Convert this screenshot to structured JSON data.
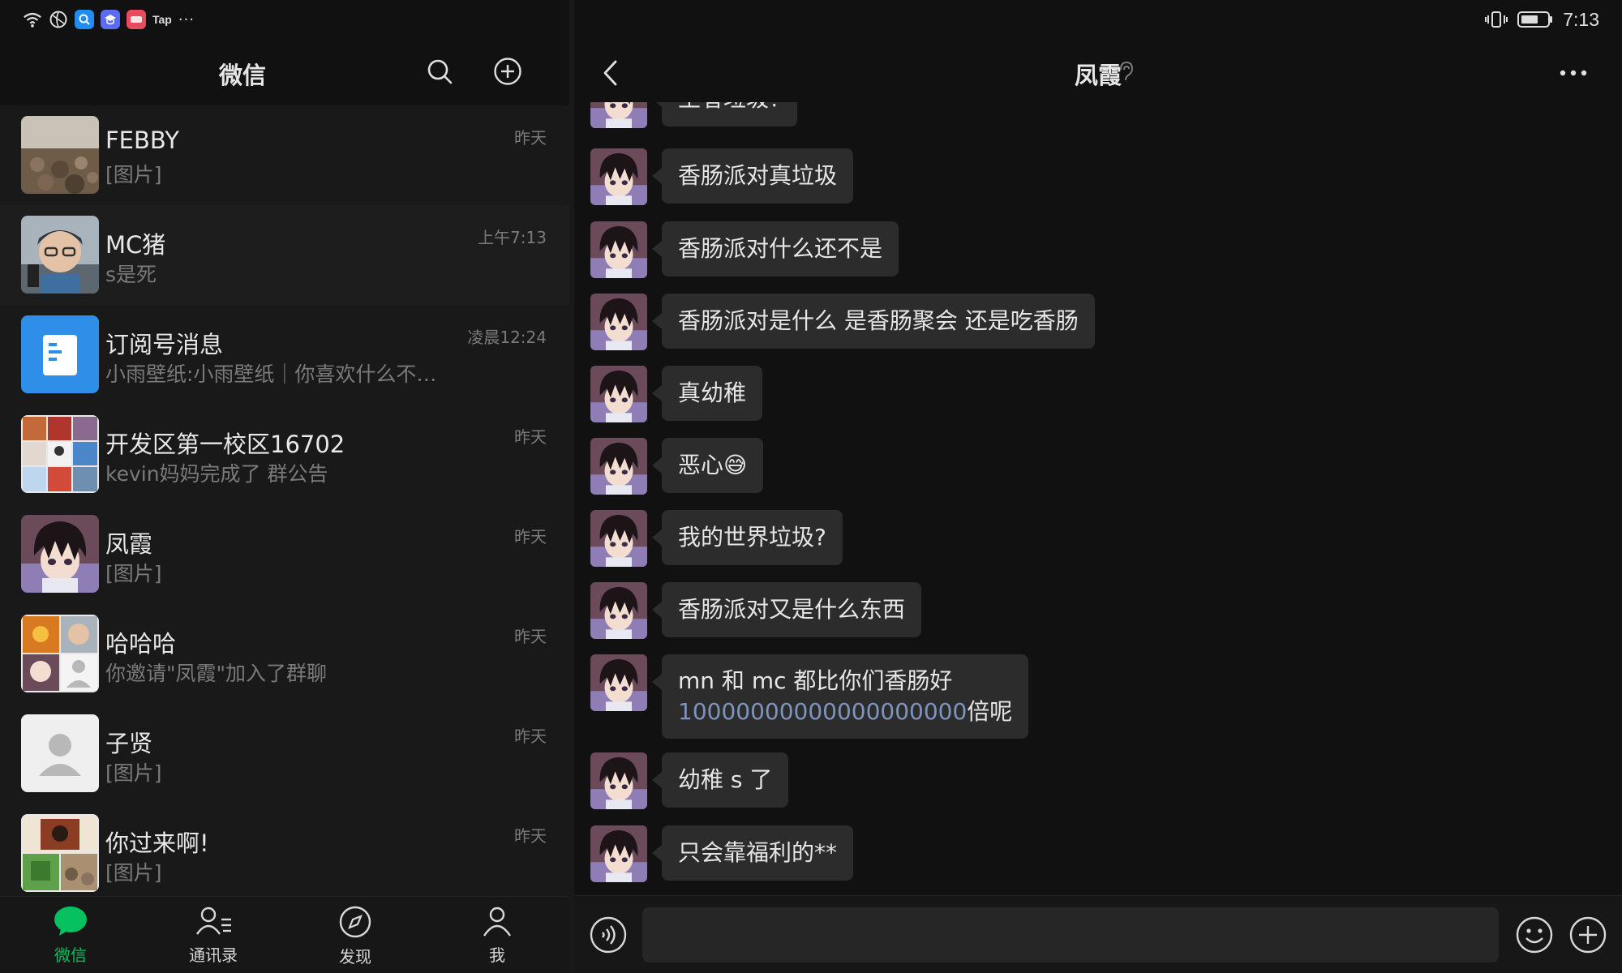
{
  "status_bar": {
    "tap_label": "Tap",
    "more_dots": "···",
    "time": "7:13"
  },
  "left_header": {
    "title": "微信"
  },
  "chats": [
    {
      "name": "FEBBY",
      "preview": "[图片]",
      "time": "昨天",
      "avatar": "sky-rocks"
    },
    {
      "name": "MC猪",
      "preview": "s是死",
      "time": "上午7:13",
      "avatar": "kid-helmet"
    },
    {
      "name": "订阅号消息",
      "preview": "小雨壁纸:小雨壁纸｜你喜欢什么不…",
      "time": "凌晨12:24",
      "avatar": "subscription-doc"
    },
    {
      "name": "开发区第一校区16702",
      "preview": "kevin妈妈完成了 群公告",
      "time": "昨天",
      "avatar": "group-grid"
    },
    {
      "name": "凤霞",
      "preview": "[图片]",
      "time": "昨天",
      "avatar": "anime-boy"
    },
    {
      "name": "哈哈哈",
      "preview": "你邀请\"凤霞\"加入了群聊",
      "time": "昨天",
      "avatar": "group-grid-2"
    },
    {
      "name": "子贤",
      "preview": "[图片]",
      "time": "昨天",
      "avatar": "default-person"
    },
    {
      "name": "你过来啊!",
      "preview": "[图片]",
      "time": "昨天",
      "avatar": "group-grid-3"
    }
  ],
  "tabs": [
    {
      "label": "微信",
      "icon": "chat-bubble-icon",
      "active": true
    },
    {
      "label": "通讯录",
      "icon": "contacts-icon",
      "active": false
    },
    {
      "label": "发现",
      "icon": "compass-icon",
      "active": false
    },
    {
      "label": "我",
      "icon": "person-icon",
      "active": false
    }
  ],
  "chat": {
    "title": "凤霞",
    "messages": [
      {
        "text": "王者垃圾?"
      },
      {
        "text": "香肠派对真垃圾"
      },
      {
        "text": "香肠派对什么还不是"
      },
      {
        "text": "香肠派对是什么 是香肠聚会 还是吃香肠"
      },
      {
        "text": "真幼稚"
      },
      {
        "text": "恶心",
        "emoji": "😅"
      },
      {
        "text": "我的世界垃圾?"
      },
      {
        "text": "香肠派对又是什么东西"
      },
      {
        "line1": "mn 和 mc 都比你们香肠好",
        "number": "10000000000000000000",
        "suffix": "倍呢"
      },
      {
        "text": "幼稚 s 了"
      },
      {
        "text": "只会靠福利的**"
      }
    ],
    "input_value": ""
  },
  "colors": {
    "accent": "#07c160",
    "bubble": "#2c2c2c",
    "background": "#111111",
    "link_number": "#7d95bd"
  }
}
